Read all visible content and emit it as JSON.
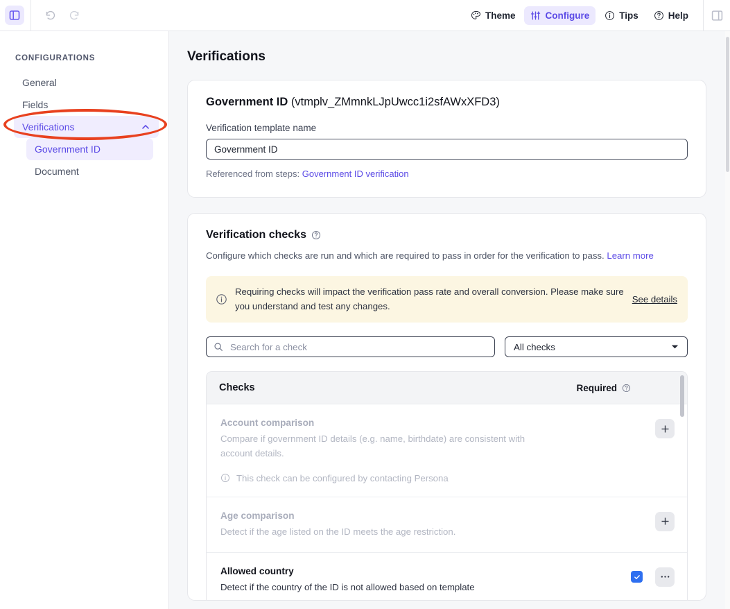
{
  "toolbar": {
    "left_panel_icon": "sidebar-toggle-icon",
    "undo_icon": "undo-icon",
    "redo_icon": "redo-icon",
    "right_panel_icon": "right-panel-toggle-icon",
    "items": [
      {
        "label": "Theme",
        "icon": "palette-icon",
        "active": false
      },
      {
        "label": "Configure",
        "icon": "sliders-icon",
        "active": true
      },
      {
        "label": "Tips",
        "icon": "info-circle-icon",
        "active": false
      },
      {
        "label": "Help",
        "icon": "question-circle-icon",
        "active": false
      }
    ],
    "accent": "#5b4ae6",
    "accent_bg": "#ece9fe"
  },
  "sidebar": {
    "heading": "CONFIGURATIONS",
    "items": [
      {
        "label": "General",
        "selected": false
      },
      {
        "label": "Fields",
        "selected": false
      },
      {
        "label": "Verifications",
        "selected": true,
        "chevron": "chevron-up-icon"
      }
    ],
    "sub_items": [
      {
        "label": "Government ID",
        "selected": true
      },
      {
        "label": "Document",
        "selected": false
      }
    ]
  },
  "main": {
    "page_title": "Verifications",
    "template": {
      "name": "Government ID",
      "id": "(vtmplv_ZMmnkLJpUwcc1i2sfAWxXFD3)",
      "field_label": "Verification template name",
      "field_value": "Government ID",
      "field_placeholder": "Verification template name",
      "referenced_prefix": "Referenced from steps: ",
      "referenced_link": "Government ID verification"
    },
    "checks_section": {
      "title": "Verification checks",
      "title_help_icon": "question-circle-icon",
      "description": "Configure which checks are run and which are required to pass in order for the verification to pass. ",
      "description_link": "Learn more",
      "banner": {
        "icon": "info-circle-icon",
        "text": "Requiring checks will impact the verification pass rate and overall conversion. Please make sure you understand and test any changes.",
        "link": "See details",
        "background": "#fcf6e2"
      },
      "search_placeholder": "Search for a check",
      "search_value": "",
      "search_icon": "search-icon",
      "filter_value": "All checks",
      "filter_caret": "caret-down-icon",
      "table_header": {
        "checks_label": "Checks",
        "required_label": "Required",
        "required_help_icon": "question-circle-icon"
      },
      "rows": [
        {
          "name": "Account comparison",
          "description": "Compare if government ID details (e.g. name, birthdate) are consistent with account details.",
          "note": "This check can be configured by contacting Persona",
          "note_icon": "info-circle-icon",
          "state": "disabled",
          "action": "add",
          "action_icon": "plus-icon",
          "required": false
        },
        {
          "name": "Age comparison",
          "description": "Detect if the age listed on the ID meets the age restriction.",
          "note": "",
          "state": "disabled",
          "action": "add",
          "action_icon": "plus-icon",
          "required": false
        },
        {
          "name": "Allowed country",
          "description": "Detect if the country of the ID is not allowed based on template",
          "note": "",
          "state": "enabled",
          "action": "menu",
          "action_icon": "ellipsis-icon",
          "required": true,
          "checkbox_color": "#2e6ff0"
        }
      ]
    }
  },
  "annotation": {
    "shape": "ellipse",
    "color": "#e8411f",
    "target": "Verifications"
  }
}
